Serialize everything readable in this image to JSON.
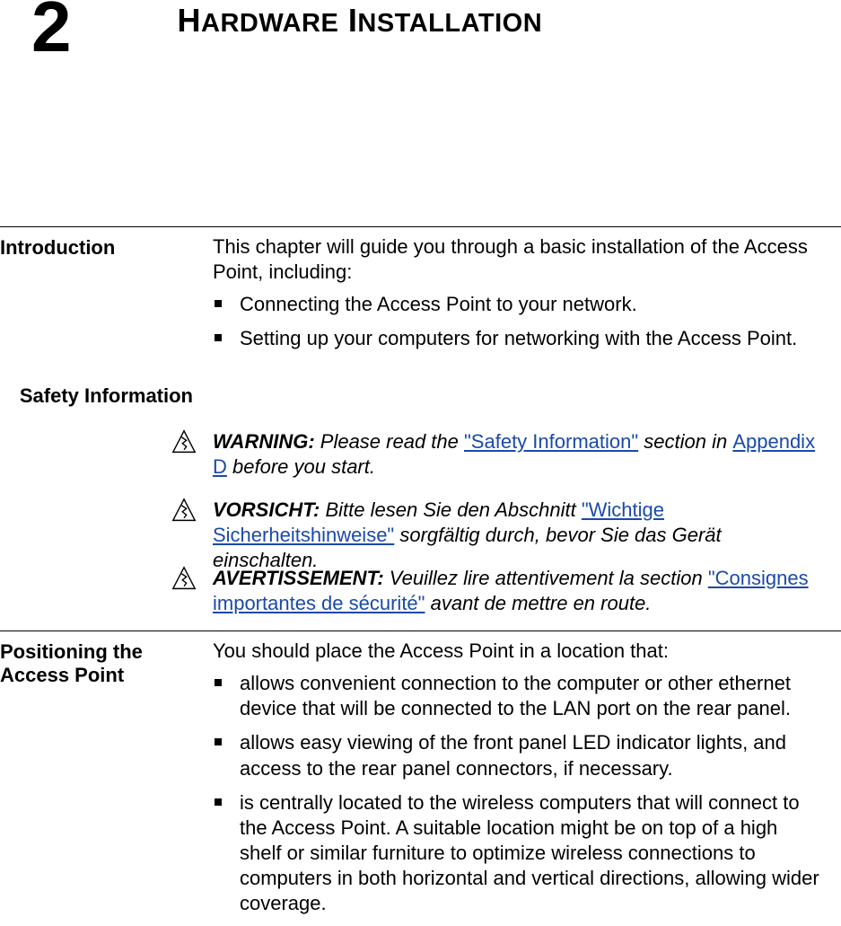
{
  "chapter": {
    "number": "2",
    "title_first": "H",
    "title_rest_1": "ARDWARE",
    "title_space": " ",
    "title_first_2": "I",
    "title_rest_2": "NSTALLATION"
  },
  "intro": {
    "heading": "Introduction",
    "lead": "This chapter will guide you through a basic installation of the Access Point, including:",
    "bullets": [
      "Connecting the Access Point to your network.",
      "Setting up your computers for networking with the Access Point."
    ]
  },
  "safety": {
    "heading": "Safety Information",
    "warning": {
      "label": "WARNING:",
      "pre": " Please read the ",
      "link1": "\"Safety Information\"",
      "mid": " section in ",
      "link2": "Appendix D",
      "post": " before you start."
    },
    "vorsicht": {
      "label": "VORSICHT:",
      "pre": " Bitte lesen Sie den Abschnitt ",
      "link1": "\"Wichtige Sicherheitshinweise\"",
      "post": " sorgfältig durch, bevor Sie das Gerät einschalten."
    },
    "avertissement": {
      "label": "AVERTISSEMENT:",
      "pre": " Veuillez lire attentivement la section ",
      "link1": "\"Consignes importantes de sécurité\"",
      "post": " avant de mettre en route."
    }
  },
  "positioning": {
    "heading": "Positioning the Access Point",
    "lead": "You should place the Access Point in a location that:",
    "bullets": [
      "allows convenient connection to the computer or other ethernet device that will be connected to the LAN port on the rear panel.",
      "allows easy viewing of the front panel LED indicator lights, and access to the rear panel connectors, if necessary.",
      "is centrally located to the wireless computers that will connect to the Access Point. A suitable location might be on top of a high shelf or similar furniture to optimize wireless connections to computers in both horizontal and vertical directions, allowing wider coverage."
    ]
  }
}
